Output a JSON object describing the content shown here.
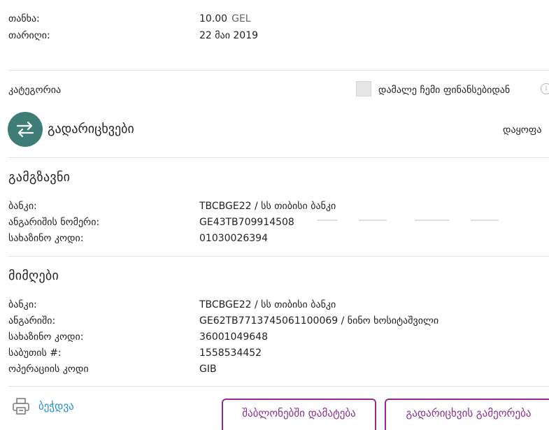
{
  "summary": {
    "amount_label": "თანხა:",
    "amount_value": "10.00",
    "currency": "GEL",
    "date_label": "თარიღი:",
    "date_value": "22 მაი 2019"
  },
  "category": {
    "label": "კატეგორია",
    "hide_checkbox_label": "დამალე ჩემი ფინანსებიდან",
    "checked": false,
    "name": "გადარიცხვები",
    "split_link": "დაყოფა",
    "icon": "transfer-arrows-icon",
    "icon_color": "#3e7e77"
  },
  "sender": {
    "title": "გამგზავნი",
    "bank_label": "ბანკი:",
    "bank_value": "TBCBGE22 / სს თიბისი ბანკი",
    "account_label": "ანგარიშის ნომერი:",
    "account_value": "GE43TB709914508",
    "treasury_label": "სახაზინო კოდი:",
    "treasury_value": "01030026394"
  },
  "receiver": {
    "title": "მიმღები",
    "bank_label": "ბანკი:",
    "bank_value": "TBCBGE22 / სს თიბისი ბანკი",
    "account_label": "ანგარიში:",
    "account_value": "GE62TB7713745061100069 / ნინო ხოსიტაშვილი",
    "treasury_label": "სახაზინო კოდი:",
    "treasury_value": "36001049648",
    "document_label": "საბუთის #:",
    "document_value": "1558534452",
    "operation_label": "ოპერაციის კოდი",
    "operation_value": "GIB"
  },
  "actions": {
    "print_label": "ბეჭდვა",
    "add_template_label": "შაბლონებში დამატება",
    "repeat_label": "გადარიცხვის გამეორება",
    "accent_color": "#8b2f8e",
    "link_color": "#1d8fc8"
  }
}
